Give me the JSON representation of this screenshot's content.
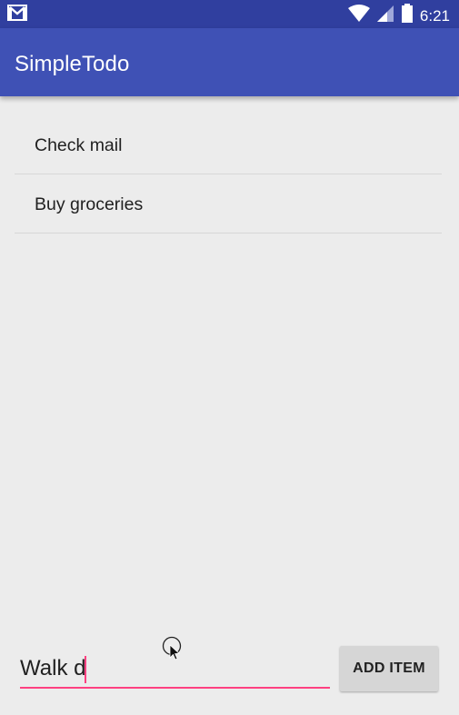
{
  "status_bar": {
    "time": "6:21",
    "icons": [
      "gmail-icon",
      "wifi-icon",
      "signal-icon",
      "battery-icon"
    ]
  },
  "app_bar": {
    "title": "SimpleTodo",
    "color": "#3f51b5",
    "status_color": "#303f9f"
  },
  "todo_list": {
    "items": [
      {
        "label": "Check mail"
      },
      {
        "label": "Buy groceries"
      }
    ]
  },
  "new_item": {
    "value": "Walk d",
    "accent": "#ff4081"
  },
  "actions": {
    "add_label": "ADD ITEM"
  }
}
